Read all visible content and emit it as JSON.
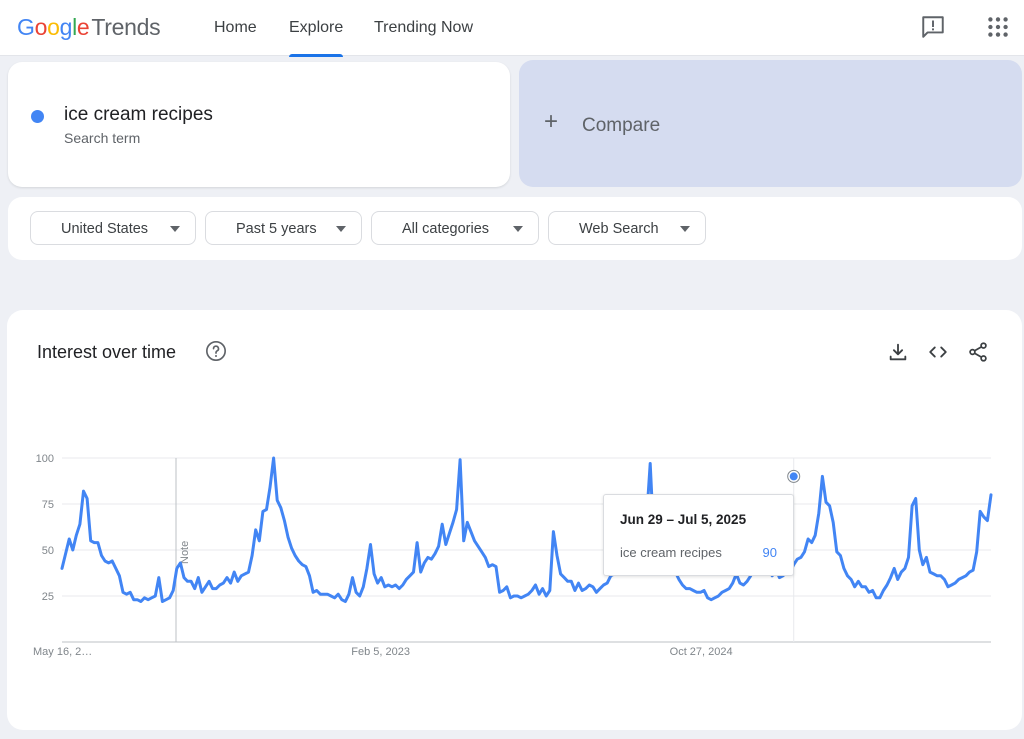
{
  "header": {
    "logo_google": "Google",
    "logo_trends": "Trends",
    "nav": [
      {
        "label": "Home"
      },
      {
        "label": "Explore",
        "active": true
      },
      {
        "label": "Trending Now"
      }
    ],
    "icons": [
      "feedback-icon",
      "apps-grid-icon"
    ]
  },
  "search": {
    "term": "ice cream recipes",
    "term_type": "Search term",
    "term_color": "#4285f4",
    "compare_label": "Compare"
  },
  "filters": [
    {
      "label": "United States"
    },
    {
      "label": "Past 5 years"
    },
    {
      "label": "All categories"
    },
    {
      "label": "Web Search"
    }
  ],
  "chart_card": {
    "title": "Interest over time",
    "icons": [
      "help-icon",
      "download-icon",
      "embed-icon",
      "share-icon"
    ]
  },
  "tooltip": {
    "date": "Jun 29 – Jul 5, 2025",
    "term": "ice cream recipes",
    "value": "90"
  },
  "chart_data": {
    "type": "line",
    "title": "Interest over time",
    "xlabel": "",
    "ylabel": "",
    "x_tick_labels": [
      "May 16, 2…",
      "Feb 5, 2023",
      "Oct 27, 2024"
    ],
    "y_ticks": [
      25,
      50,
      75,
      100
    ],
    "ylim": [
      0,
      100
    ],
    "grid": true,
    "note_marker": "Note",
    "series": [
      {
        "name": "ice cream recipes",
        "color": "#4285f4",
        "values": [
          40,
          48,
          56,
          50,
          58,
          64,
          82,
          78,
          55,
          54,
          54,
          47,
          44,
          43,
          44,
          40,
          36,
          27,
          26,
          27,
          23,
          23,
          22,
          24,
          23,
          24,
          25,
          35,
          22,
          23,
          24,
          28,
          40,
          43,
          35,
          33,
          33,
          29,
          35,
          27,
          30,
          33,
          29,
          29,
          31,
          32,
          35,
          32,
          38,
          33,
          36,
          37,
          38,
          47,
          61,
          55,
          71,
          72,
          84,
          100,
          77,
          73,
          66,
          57,
          51,
          47,
          44,
          42,
          41,
          36,
          27,
          28,
          26,
          26,
          26,
          25,
          24,
          26,
          23,
          22,
          26,
          35,
          27,
          25,
          30,
          40,
          53,
          37,
          32,
          35,
          30,
          31,
          30,
          31,
          29,
          31,
          34,
          36,
          38,
          54,
          38,
          43,
          46,
          45,
          48,
          52,
          64,
          53,
          59,
          65,
          72,
          99,
          55,
          65,
          60,
          55,
          52,
          49,
          46,
          41,
          42,
          41,
          27,
          28,
          30,
          24,
          25,
          25,
          24,
          25,
          26,
          28,
          31,
          26,
          29,
          25,
          28,
          60,
          47,
          37,
          35,
          33,
          33,
          28,
          32,
          28,
          29,
          31,
          30,
          27,
          29,
          31,
          32,
          36,
          37,
          38,
          40,
          44,
          44,
          45,
          52,
          56,
          58,
          68,
          97,
          56,
          54,
          51,
          48,
          44,
          41,
          38,
          34,
          31,
          29,
          29,
          28,
          27,
          27,
          28,
          24,
          23,
          24,
          25,
          27,
          28,
          29,
          32,
          37,
          32,
          31,
          33,
          36,
          41,
          44,
          38,
          39,
          39,
          36,
          40,
          35,
          36,
          38,
          38,
          42,
          45,
          46,
          49,
          56,
          54,
          58,
          70,
          90,
          76,
          74,
          65,
          49,
          47,
          40,
          36,
          34,
          30,
          33,
          30,
          30,
          27,
          28,
          24,
          24,
          28,
          31,
          35,
          40,
          34,
          38,
          40,
          46,
          74,
          78,
          50,
          42,
          46,
          38,
          37,
          36,
          36,
          34,
          30,
          31,
          32,
          34,
          35,
          36,
          38,
          39,
          49,
          71,
          68,
          66,
          80
        ]
      }
    ],
    "highlight": {
      "index": 204,
      "value": 90
    }
  }
}
